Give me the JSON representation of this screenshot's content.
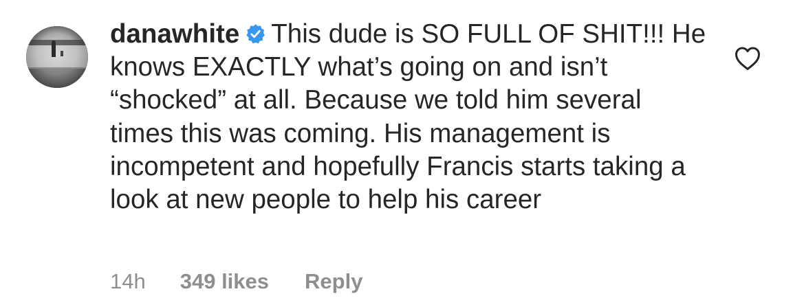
{
  "comment": {
    "username": "danawhite",
    "verified_icon": "verified-badge-icon",
    "text": "This dude is SO FULL OF SHIT!!! He knows EXACTLY what’s going on and isn’t “shocked” at all. Because we told him several times this was coming. His management is incompetent and hopefully Francis starts taking a look at new people to help his career"
  },
  "meta": {
    "time": "14h",
    "likes": "349 likes",
    "reply": "Reply"
  },
  "icons": {
    "like": "heart-outline-icon"
  },
  "colors": {
    "text": "#262626",
    "secondary": "#8e8e8e",
    "verified": "#3897f0"
  }
}
